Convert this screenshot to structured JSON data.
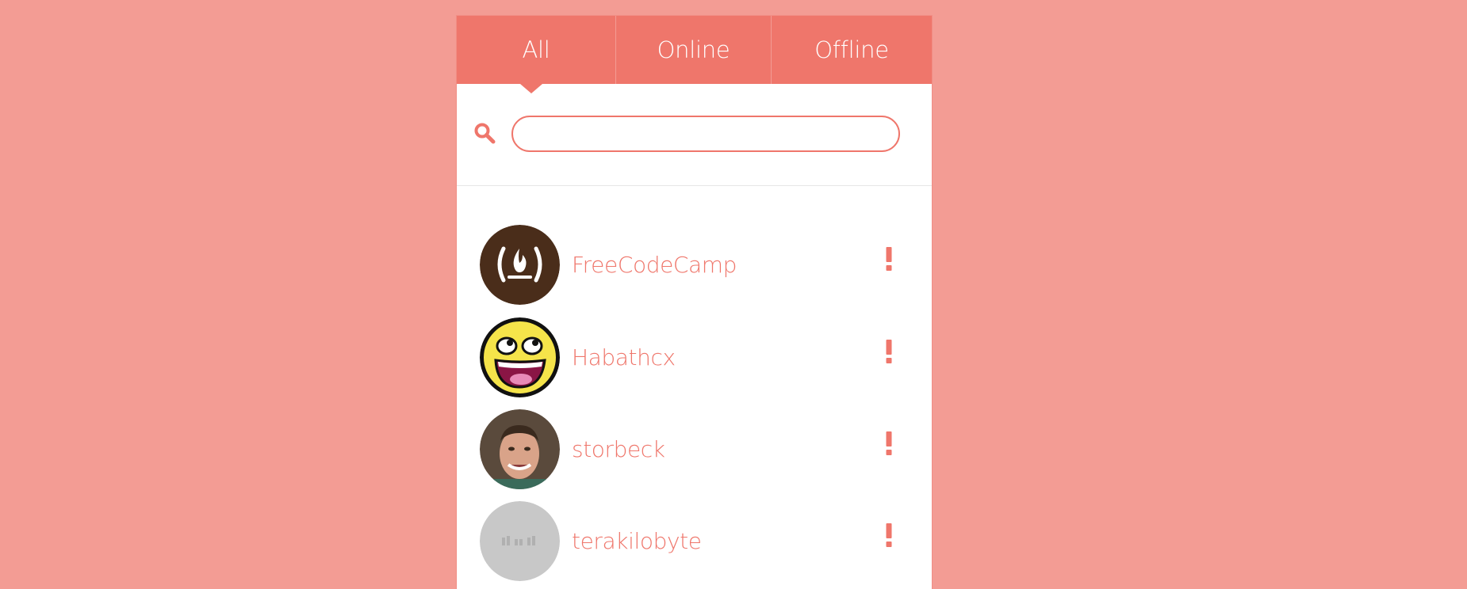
{
  "tabs": [
    {
      "label": "All"
    },
    {
      "label": "Online"
    },
    {
      "label": "Offline"
    }
  ],
  "search": {
    "value": "",
    "icon": "search-icon"
  },
  "channels": [
    {
      "name": "FreeCodeCamp",
      "avatar": "freecodecamp-logo",
      "status_icon": "exclamation-icon"
    },
    {
      "name": "Habathcx",
      "avatar": "awesome-face",
      "status_icon": "exclamation-icon"
    },
    {
      "name": "storbeck",
      "avatar": "user-photo",
      "status_icon": "exclamation-icon"
    },
    {
      "name": "terakilobyte",
      "avatar": "placeholder-avatar",
      "status_icon": "exclamation-icon"
    }
  ],
  "colors": {
    "background": "#f39c94",
    "accent": "#ef766b",
    "panel": "#ffffff"
  }
}
